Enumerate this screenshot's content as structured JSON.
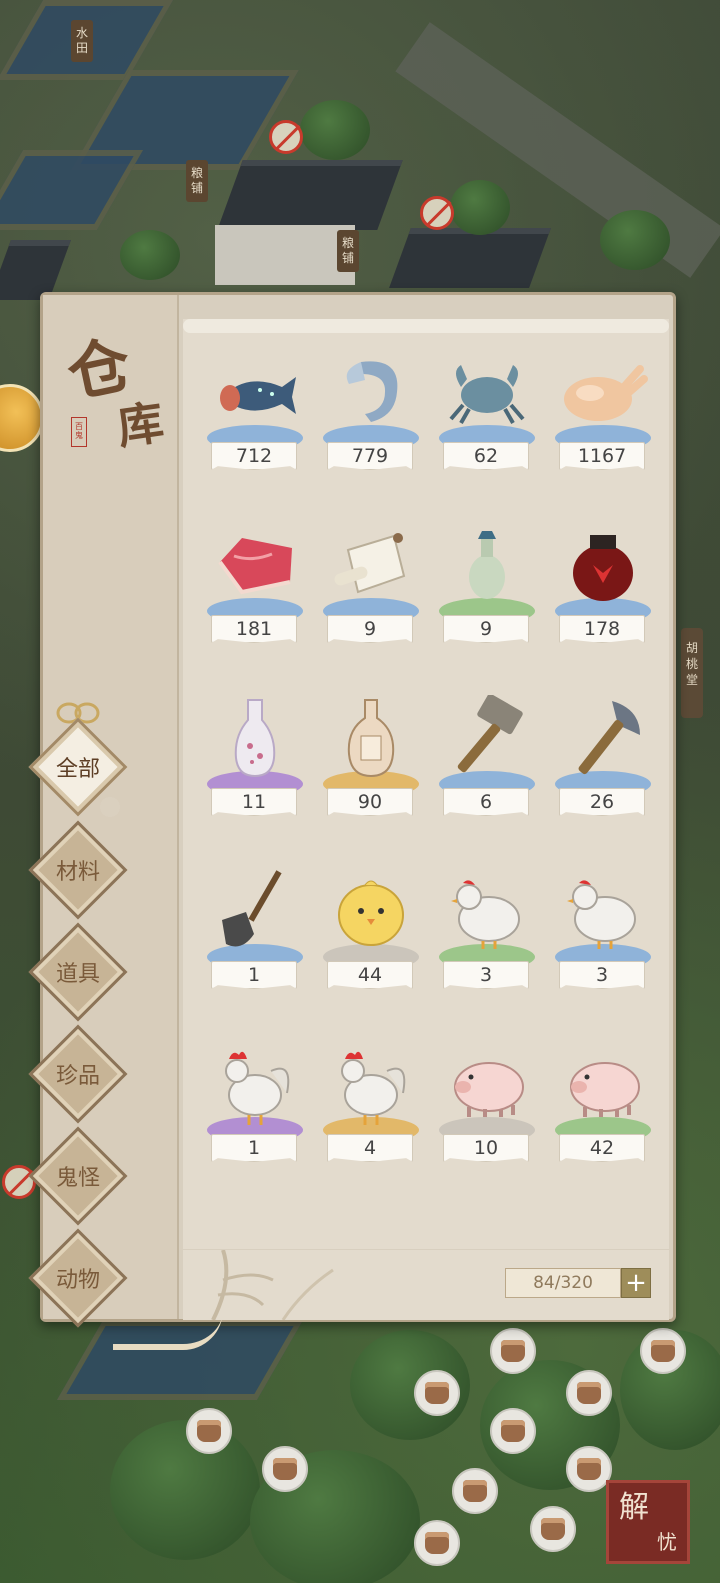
{
  "world": {
    "signs": [
      "水田",
      "粮铺",
      "粮铺"
    ],
    "right_tab": "胡桃堂",
    "jieyou_main": "解",
    "jieyou_sub": "忧"
  },
  "warehouse": {
    "title_char1": "仓",
    "title_char2": "库",
    "seal": "百鬼",
    "categories": [
      {
        "label": "全部",
        "active": true
      },
      {
        "label": "材料",
        "active": false
      },
      {
        "label": "道具",
        "active": false
      },
      {
        "label": "珍品",
        "active": false
      },
      {
        "label": "鬼怪",
        "active": false
      },
      {
        "label": "动物",
        "active": false
      }
    ],
    "items": [
      {
        "icon": "fish-icon",
        "count": "712",
        "rarity": "blue"
      },
      {
        "icon": "shrimp-icon",
        "count": "779",
        "rarity": "blue"
      },
      {
        "icon": "crab-icon",
        "count": "62",
        "rarity": "blue"
      },
      {
        "icon": "roast-chicken-icon",
        "count": "1167",
        "rarity": "blue"
      },
      {
        "icon": "meat-icon",
        "count": "181",
        "rarity": "blue"
      },
      {
        "icon": "scroll-icon",
        "count": "9",
        "rarity": "blue"
      },
      {
        "icon": "small-bottle-icon",
        "count": "9",
        "rarity": "green"
      },
      {
        "icon": "wine-jar-icon",
        "count": "178",
        "rarity": "blue"
      },
      {
        "icon": "sake-bottle-icon",
        "count": "11",
        "rarity": "purple"
      },
      {
        "icon": "wine-bottle-icon",
        "count": "90",
        "rarity": "orange"
      },
      {
        "icon": "hammer-icon",
        "count": "6",
        "rarity": "blue"
      },
      {
        "icon": "axe-icon",
        "count": "26",
        "rarity": "blue"
      },
      {
        "icon": "shovel-icon",
        "count": "1",
        "rarity": "blue"
      },
      {
        "icon": "chick-icon",
        "count": "44",
        "rarity": "gray"
      },
      {
        "icon": "hen-icon",
        "count": "3",
        "rarity": "green"
      },
      {
        "icon": "hen-icon",
        "count": "3",
        "rarity": "blue"
      },
      {
        "icon": "rooster-icon",
        "count": "1",
        "rarity": "purple"
      },
      {
        "icon": "rooster-icon",
        "count": "4",
        "rarity": "orange"
      },
      {
        "icon": "pig-icon",
        "count": "10",
        "rarity": "gray"
      },
      {
        "icon": "pig-icon",
        "count": "42",
        "rarity": "green"
      }
    ],
    "capacity": "84/320",
    "add_label": "+"
  },
  "colors": {
    "rarity": {
      "blue": "#8fb3d9",
      "green": "#9cc68a",
      "purple": "#b28fd2",
      "orange": "#e2b869",
      "gray": "#cbc5bb"
    }
  }
}
